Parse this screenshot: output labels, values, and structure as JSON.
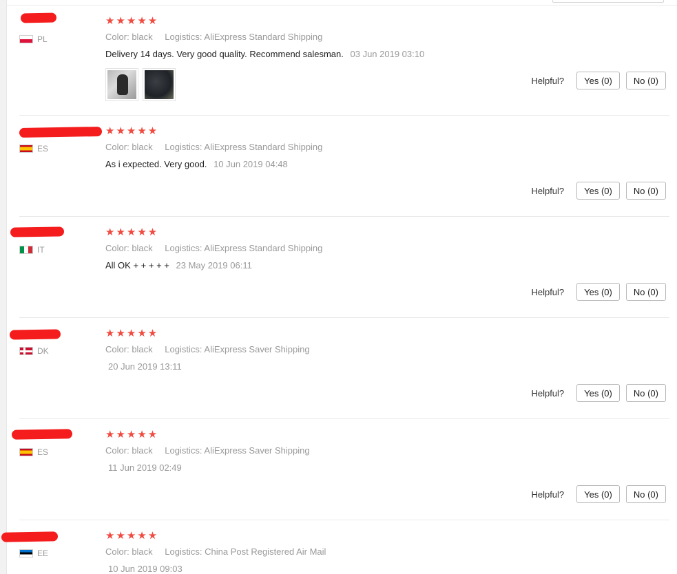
{
  "helpful_label": "Helpful?",
  "stars": "★★★★★",
  "meta_labels": {
    "color": "Color:",
    "logistics": "Logistics:"
  },
  "colors": {
    "star": "#f04b41",
    "redaction": "#f41c1c"
  },
  "reviews": [
    {
      "country": "PL",
      "flag": "flag-pl",
      "color": "black",
      "logistics": "AliExpress Standard Shipping",
      "feedback": "Delivery 14 days. Very good quality. Recommend salesman.",
      "date": "03 Jun 2019 03:10",
      "photos": [
        "photo-gloves",
        "photo-dark-fabric"
      ],
      "yes": "Yes (0)",
      "no": "No (0)"
    },
    {
      "country": "ES",
      "flag": "flag-es",
      "color": "black",
      "logistics": "AliExpress Standard Shipping",
      "feedback": "As i expected. Very good.",
      "date": "10 Jun 2019 04:48",
      "yes": "Yes (0)",
      "no": "No (0)"
    },
    {
      "country": "IT",
      "flag": "flag-it",
      "color": "black",
      "logistics": "AliExpress Standard Shipping",
      "feedback": "All OK + + + + +",
      "date": "23 May 2019 06:11",
      "yes": "Yes (0)",
      "no": "No (0)"
    },
    {
      "country": "DK",
      "flag": "flag-dk",
      "color": "black",
      "logistics": "AliExpress Saver Shipping",
      "feedback": "",
      "date": "20 Jun 2019 13:11",
      "yes": "Yes (0)",
      "no": "No (0)"
    },
    {
      "country": "ES",
      "flag": "flag-es",
      "color": "black",
      "logistics": "AliExpress Saver Shipping",
      "feedback": "",
      "date": "11 Jun 2019 02:49",
      "yes": "Yes (0)",
      "no": "No (0)"
    },
    {
      "country": "EE",
      "flag": "flag-ee",
      "color": "black",
      "logistics": "China Post Registered Air Mail",
      "feedback": "",
      "date": "10 Jun 2019 09:03"
    }
  ]
}
